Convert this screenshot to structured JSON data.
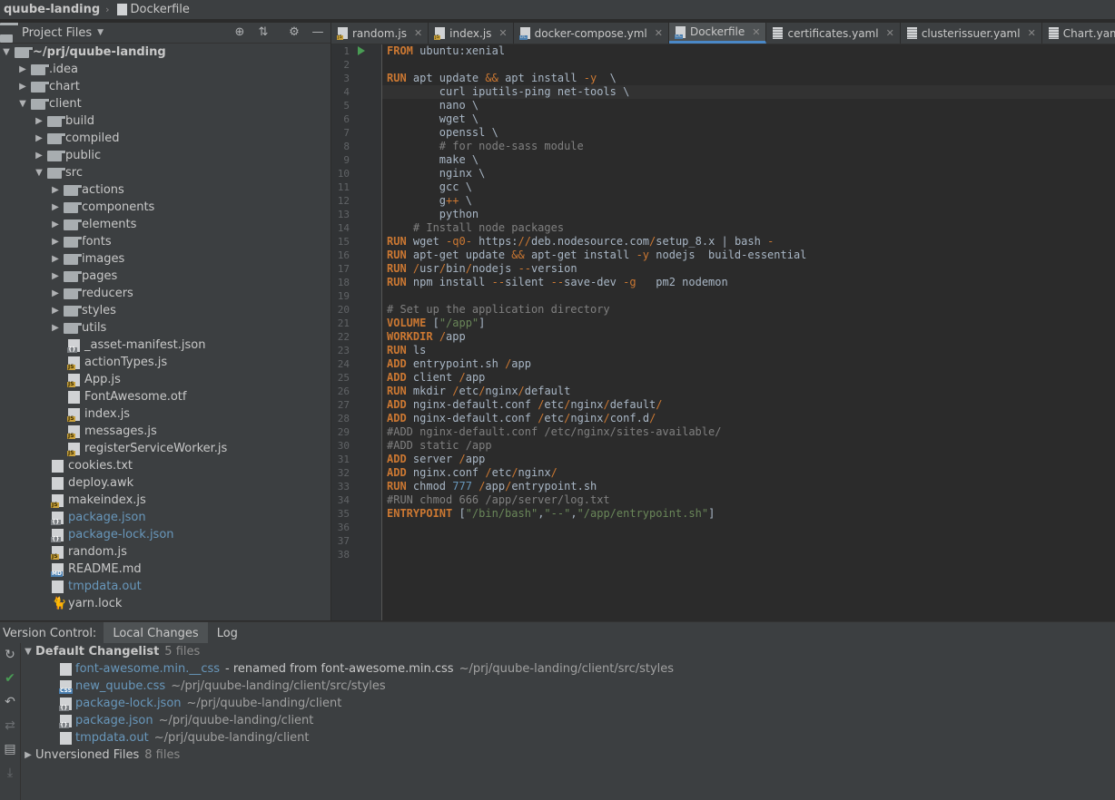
{
  "breadcrumb": {
    "project": "quube-landing",
    "file": "Dockerfile"
  },
  "project_panel": {
    "title": "Project Files",
    "tools": [
      "locate-icon",
      "collapse-icon",
      "settings-icon",
      "hide-icon"
    ],
    "tree": [
      {
        "depth": 0,
        "type": "folder",
        "open": true,
        "label": "~/prj/quube-landing",
        "bold": true
      },
      {
        "depth": 1,
        "type": "folder",
        "open": false,
        "label": ".idea"
      },
      {
        "depth": 1,
        "type": "folder",
        "open": false,
        "label": "chart"
      },
      {
        "depth": 1,
        "type": "folder",
        "open": true,
        "label": "client"
      },
      {
        "depth": 2,
        "type": "folder",
        "open": false,
        "label": "build"
      },
      {
        "depth": 2,
        "type": "folder",
        "open": false,
        "label": "compiled"
      },
      {
        "depth": 2,
        "type": "folder",
        "open": false,
        "label": "public"
      },
      {
        "depth": 2,
        "type": "folder",
        "open": true,
        "label": "src"
      },
      {
        "depth": 3,
        "type": "folder",
        "open": false,
        "label": "actions"
      },
      {
        "depth": 3,
        "type": "folder",
        "open": false,
        "label": "components"
      },
      {
        "depth": 3,
        "type": "folder",
        "open": false,
        "label": "elements"
      },
      {
        "depth": 3,
        "type": "folder",
        "open": false,
        "label": "fonts"
      },
      {
        "depth": 3,
        "type": "folder",
        "open": false,
        "label": "images"
      },
      {
        "depth": 3,
        "type": "folder",
        "open": false,
        "label": "pages"
      },
      {
        "depth": 3,
        "type": "folder",
        "open": false,
        "label": "reducers"
      },
      {
        "depth": 3,
        "type": "folder",
        "open": false,
        "label": "styles"
      },
      {
        "depth": 3,
        "type": "folder",
        "open": false,
        "label": "utils"
      },
      {
        "depth": 3,
        "type": "file",
        "icon": "json",
        "label": "_asset-manifest.json"
      },
      {
        "depth": 3,
        "type": "file",
        "icon": "js",
        "label": "actionTypes.js"
      },
      {
        "depth": 3,
        "type": "file",
        "icon": "js",
        "label": "App.js"
      },
      {
        "depth": 3,
        "type": "file",
        "icon": "font",
        "label": "FontAwesome.otf"
      },
      {
        "depth": 3,
        "type": "file",
        "icon": "js",
        "label": "index.js"
      },
      {
        "depth": 3,
        "type": "file",
        "icon": "js",
        "label": "messages.js"
      },
      {
        "depth": 3,
        "type": "file",
        "icon": "js",
        "label": "registerServiceWorker.js"
      },
      {
        "depth": 2,
        "type": "file",
        "icon": "text",
        "label": "cookies.txt"
      },
      {
        "depth": 2,
        "type": "file",
        "icon": "text",
        "label": "deploy.awk"
      },
      {
        "depth": 2,
        "type": "file",
        "icon": "js",
        "label": "makeindex.js"
      },
      {
        "depth": 2,
        "type": "file",
        "icon": "json",
        "label": "package.json",
        "blue": true
      },
      {
        "depth": 2,
        "type": "file",
        "icon": "json",
        "label": "package-lock.json",
        "blue": true
      },
      {
        "depth": 2,
        "type": "file",
        "icon": "js",
        "label": "random.js"
      },
      {
        "depth": 2,
        "type": "file",
        "icon": "md",
        "label": "README.md"
      },
      {
        "depth": 2,
        "type": "file",
        "icon": "text",
        "label": "tmpdata.out",
        "blue": true
      },
      {
        "depth": 2,
        "type": "file",
        "icon": "yarn",
        "label": "yarn.lock"
      }
    ]
  },
  "tabs": [
    {
      "label": "random.js",
      "icon": "js",
      "active": false
    },
    {
      "label": "index.js",
      "icon": "js",
      "active": false
    },
    {
      "label": "docker-compose.yml",
      "icon": "docker",
      "active": false
    },
    {
      "label": "Dockerfile",
      "icon": "docker",
      "active": true
    },
    {
      "label": "certificates.yaml",
      "icon": "yaml",
      "active": false
    },
    {
      "label": "clusterissuer.yaml",
      "icon": "yaml",
      "active": false
    },
    {
      "label": "Chart.yaml",
      "icon": "yaml",
      "active": false
    }
  ],
  "editor": {
    "current_line": 4,
    "lines": [
      [
        [
          "kw",
          "FROM"
        ],
        [
          "t",
          " ubuntu:xenial"
        ]
      ],
      [],
      [
        [
          "kw",
          "RUN"
        ],
        [
          "t",
          " apt update "
        ],
        [
          "op",
          "&&"
        ],
        [
          "t",
          " apt install "
        ],
        [
          "op",
          "-y"
        ],
        [
          "t",
          "  \\"
        ]
      ],
      [
        [
          "t",
          "        curl iputils-ping net-tools \\"
        ]
      ],
      [
        [
          "t",
          "        nano \\"
        ]
      ],
      [
        [
          "t",
          "        wget \\"
        ]
      ],
      [
        [
          "t",
          "        openssl \\"
        ]
      ],
      [
        [
          "cm",
          "        # for node-sass module"
        ]
      ],
      [
        [
          "t",
          "        make \\"
        ]
      ],
      [
        [
          "t",
          "        nginx \\"
        ]
      ],
      [
        [
          "t",
          "        gcc \\"
        ]
      ],
      [
        [
          "t",
          "        g"
        ],
        [
          "op",
          "++"
        ],
        [
          "t",
          " \\"
        ]
      ],
      [
        [
          "t",
          "        python"
        ]
      ],
      [
        [
          "cm",
          "    # Install node packages"
        ]
      ],
      [
        [
          "kw",
          "RUN"
        ],
        [
          "t",
          " wget "
        ],
        [
          "op",
          "-q0-"
        ],
        [
          "t",
          " https:"
        ],
        [
          "op",
          "//"
        ],
        [
          "t",
          "deb.nodesource.com"
        ],
        [
          "op",
          "/"
        ],
        [
          "t",
          "setup_8.x | bash "
        ],
        [
          "op",
          "-"
        ]
      ],
      [
        [
          "kw",
          "RUN"
        ],
        [
          "t",
          " apt-get update "
        ],
        [
          "op",
          "&&"
        ],
        [
          "t",
          " apt-get install "
        ],
        [
          "op",
          "-y"
        ],
        [
          "t",
          " nodejs  build-essential"
        ]
      ],
      [
        [
          "kw",
          "RUN"
        ],
        [
          "t",
          " "
        ],
        [
          "op",
          "/"
        ],
        [
          "t",
          "usr"
        ],
        [
          "op",
          "/"
        ],
        [
          "t",
          "bin"
        ],
        [
          "op",
          "/"
        ],
        [
          "t",
          "nodejs "
        ],
        [
          "op",
          "--"
        ],
        [
          "t",
          "version"
        ]
      ],
      [
        [
          "kw",
          "RUN"
        ],
        [
          "t",
          " npm install "
        ],
        [
          "op",
          "--"
        ],
        [
          "t",
          "silent "
        ],
        [
          "op",
          "--"
        ],
        [
          "t",
          "save-dev "
        ],
        [
          "op",
          "-g"
        ],
        [
          "t",
          "   pm2 nodemon"
        ]
      ],
      [],
      [
        [
          "cm",
          "# Set up the application directory"
        ]
      ],
      [
        [
          "kw",
          "VOLUME"
        ],
        [
          "t",
          " ["
        ],
        [
          "str",
          "\"/app\""
        ],
        [
          "t",
          "]"
        ]
      ],
      [
        [
          "kw",
          "WORKDIR"
        ],
        [
          "t",
          " "
        ],
        [
          "op",
          "/"
        ],
        [
          "t",
          "app"
        ]
      ],
      [
        [
          "kw",
          "RUN"
        ],
        [
          "t",
          " ls"
        ]
      ],
      [
        [
          "kw",
          "ADD"
        ],
        [
          "t",
          " entrypoint.sh "
        ],
        [
          "op",
          "/"
        ],
        [
          "t",
          "app"
        ]
      ],
      [
        [
          "kw",
          "ADD"
        ],
        [
          "t",
          " client "
        ],
        [
          "op",
          "/"
        ],
        [
          "t",
          "app"
        ]
      ],
      [
        [
          "kw",
          "RUN"
        ],
        [
          "t",
          " mkdir "
        ],
        [
          "op",
          "/"
        ],
        [
          "t",
          "etc"
        ],
        [
          "op",
          "/"
        ],
        [
          "t",
          "nginx"
        ],
        [
          "op",
          "/"
        ],
        [
          "t",
          "default"
        ]
      ],
      [
        [
          "kw",
          "ADD"
        ],
        [
          "t",
          " nginx-default.conf "
        ],
        [
          "op",
          "/"
        ],
        [
          "t",
          "etc"
        ],
        [
          "op",
          "/"
        ],
        [
          "t",
          "nginx"
        ],
        [
          "op",
          "/"
        ],
        [
          "t",
          "default"
        ],
        [
          "op",
          "/"
        ]
      ],
      [
        [
          "kw",
          "ADD"
        ],
        [
          "t",
          " nginx-default.conf "
        ],
        [
          "op",
          "/"
        ],
        [
          "t",
          "etc"
        ],
        [
          "op",
          "/"
        ],
        [
          "t",
          "nginx"
        ],
        [
          "op",
          "/"
        ],
        [
          "t",
          "conf.d"
        ],
        [
          "op",
          "/"
        ]
      ],
      [
        [
          "cm",
          "#ADD nginx-default.conf /etc/nginx/sites-available/"
        ]
      ],
      [
        [
          "cm",
          "#ADD static /app"
        ]
      ],
      [
        [
          "kw",
          "ADD"
        ],
        [
          "t",
          " server "
        ],
        [
          "op",
          "/"
        ],
        [
          "t",
          "app"
        ]
      ],
      [
        [
          "kw",
          "ADD"
        ],
        [
          "t",
          " nginx.conf "
        ],
        [
          "op",
          "/"
        ],
        [
          "t",
          "etc"
        ],
        [
          "op",
          "/"
        ],
        [
          "t",
          "nginx"
        ],
        [
          "op",
          "/"
        ]
      ],
      [
        [
          "kw",
          "RUN"
        ],
        [
          "t",
          " chmod "
        ],
        [
          "num",
          "777"
        ],
        [
          "t",
          " "
        ],
        [
          "op",
          "/"
        ],
        [
          "t",
          "app"
        ],
        [
          "op",
          "/"
        ],
        [
          "t",
          "entrypoint.sh"
        ]
      ],
      [
        [
          "cm",
          "#RUN chmod 666 /app/server/log.txt"
        ]
      ],
      [
        [
          "kw",
          "ENTRYPOINT"
        ],
        [
          "t",
          " ["
        ],
        [
          "str",
          "\"/bin/bash\""
        ],
        [
          "t",
          ","
        ],
        [
          "str",
          "\"--\""
        ],
        [
          "t",
          ","
        ],
        [
          "str",
          "\"/app/entrypoint.sh\""
        ],
        [
          "t",
          "]"
        ]
      ],
      [],
      [],
      []
    ]
  },
  "version_control": {
    "label": "Version Control:",
    "tabs": [
      {
        "label": "Local Changes",
        "selected": true
      },
      {
        "label": "Log",
        "selected": false
      }
    ],
    "side_icons": [
      "refresh-icon",
      "commit-check-icon",
      "rollback-icon",
      "diff-icon",
      "changelist-icon",
      "shelve-icon"
    ],
    "changelist": {
      "name": "Default Changelist",
      "count": "5 files"
    },
    "changes": [
      {
        "file": "font-awesome.min.__css",
        "note": "- renamed from font-awesome.min.css",
        "path": "~/prj/quube-landing/client/src/styles",
        "icon": "text"
      },
      {
        "file": "new_quube.css",
        "note": "",
        "path": "~/prj/quube-landing/client/src/styles",
        "icon": "css"
      },
      {
        "file": "package-lock.json",
        "note": "",
        "path": "~/prj/quube-landing/client",
        "icon": "json"
      },
      {
        "file": "package.json",
        "note": "",
        "path": "~/prj/quube-landing/client",
        "icon": "json"
      },
      {
        "file": "tmpdata.out",
        "note": "",
        "path": "~/prj/quube-landing/client",
        "icon": "text"
      }
    ],
    "unversioned": {
      "name": "Unversioned Files",
      "count": "8 files"
    }
  }
}
